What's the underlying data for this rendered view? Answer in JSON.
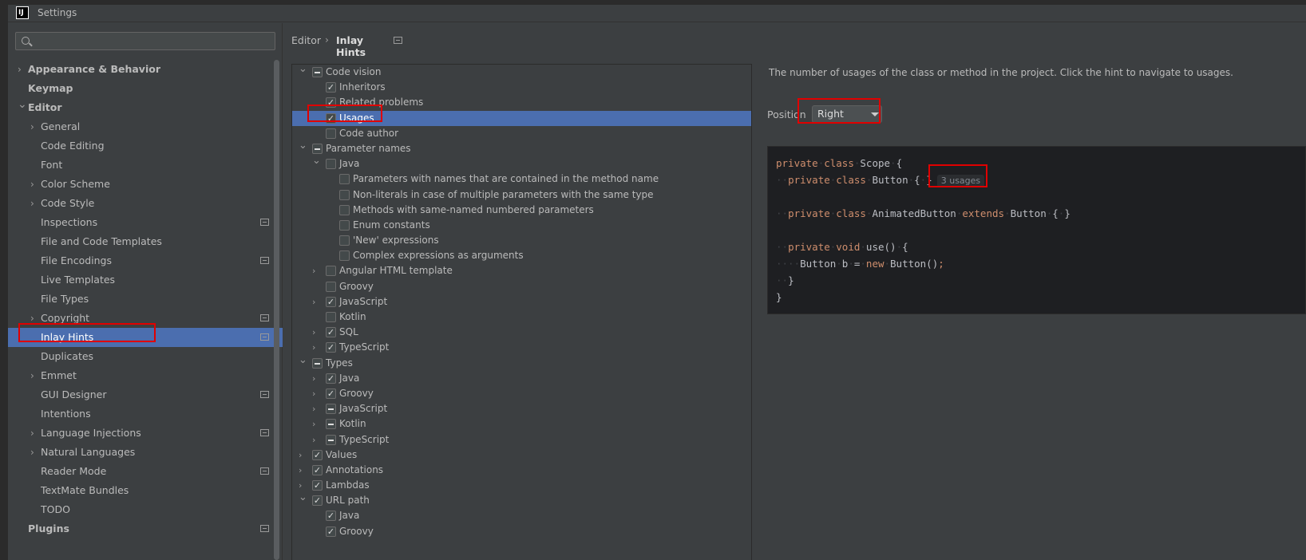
{
  "window": {
    "title": "Settings"
  },
  "search": {
    "placeholder": ""
  },
  "sidebar": {
    "items": [
      {
        "label": "Appearance & Behavior",
        "level": 0,
        "bold": true,
        "chevron": "right",
        "icon": false,
        "selected": false
      },
      {
        "label": "Keymap",
        "level": 0,
        "bold": true,
        "chevron": "",
        "icon": false,
        "selected": false
      },
      {
        "label": "Editor",
        "level": 0,
        "bold": true,
        "chevron": "down",
        "icon": false,
        "selected": false
      },
      {
        "label": "General",
        "level": 1,
        "bold": false,
        "chevron": "right",
        "icon": false,
        "selected": false
      },
      {
        "label": "Code Editing",
        "level": 1,
        "bold": false,
        "chevron": "",
        "icon": false,
        "selected": false
      },
      {
        "label": "Font",
        "level": 1,
        "bold": false,
        "chevron": "",
        "icon": false,
        "selected": false
      },
      {
        "label": "Color Scheme",
        "level": 1,
        "bold": false,
        "chevron": "right",
        "icon": false,
        "selected": false
      },
      {
        "label": "Code Style",
        "level": 1,
        "bold": false,
        "chevron": "right",
        "icon": false,
        "selected": false
      },
      {
        "label": "Inspections",
        "level": 1,
        "bold": false,
        "chevron": "",
        "icon": true,
        "selected": false
      },
      {
        "label": "File and Code Templates",
        "level": 1,
        "bold": false,
        "chevron": "",
        "icon": false,
        "selected": false
      },
      {
        "label": "File Encodings",
        "level": 1,
        "bold": false,
        "chevron": "",
        "icon": true,
        "selected": false
      },
      {
        "label": "Live Templates",
        "level": 1,
        "bold": false,
        "chevron": "",
        "icon": false,
        "selected": false
      },
      {
        "label": "File Types",
        "level": 1,
        "bold": false,
        "chevron": "",
        "icon": false,
        "selected": false
      },
      {
        "label": "Copyright",
        "level": 1,
        "bold": false,
        "chevron": "right",
        "icon": true,
        "selected": false
      },
      {
        "label": "Inlay Hints",
        "level": 1,
        "bold": false,
        "chevron": "",
        "icon": true,
        "selected": true
      },
      {
        "label": "Duplicates",
        "level": 1,
        "bold": false,
        "chevron": "",
        "icon": false,
        "selected": false
      },
      {
        "label": "Emmet",
        "level": 1,
        "bold": false,
        "chevron": "right",
        "icon": false,
        "selected": false
      },
      {
        "label": "GUI Designer",
        "level": 1,
        "bold": false,
        "chevron": "",
        "icon": true,
        "selected": false
      },
      {
        "label": "Intentions",
        "level": 1,
        "bold": false,
        "chevron": "",
        "icon": false,
        "selected": false
      },
      {
        "label": "Language Injections",
        "level": 1,
        "bold": false,
        "chevron": "right",
        "icon": true,
        "selected": false
      },
      {
        "label": "Natural Languages",
        "level": 1,
        "bold": false,
        "chevron": "right",
        "icon": false,
        "selected": false
      },
      {
        "label": "Reader Mode",
        "level": 1,
        "bold": false,
        "chevron": "",
        "icon": true,
        "selected": false
      },
      {
        "label": "TextMate Bundles",
        "level": 1,
        "bold": false,
        "chevron": "",
        "icon": false,
        "selected": false
      },
      {
        "label": "TODO",
        "level": 1,
        "bold": false,
        "chevron": "",
        "icon": false,
        "selected": false
      },
      {
        "label": "Plugins",
        "level": 0,
        "bold": true,
        "chevron": "",
        "icon": true,
        "selected": false
      }
    ]
  },
  "breadcrumb": {
    "root": "Editor",
    "separator": "›",
    "page": "Inlay Hints"
  },
  "hints": [
    {
      "label": "Code vision",
      "level": 0,
      "chevron": "down",
      "check": "partial",
      "selected": false
    },
    {
      "label": "Inheritors",
      "level": 1,
      "chevron": "",
      "check": "checked",
      "selected": false
    },
    {
      "label": "Related problems",
      "level": 1,
      "chevron": "",
      "check": "checked",
      "selected": false
    },
    {
      "label": "Usages",
      "level": 1,
      "chevron": "",
      "check": "checked",
      "selected": true
    },
    {
      "label": "Code author",
      "level": 1,
      "chevron": "",
      "check": "unchecked",
      "selected": false
    },
    {
      "label": "Parameter names",
      "level": 0,
      "chevron": "down",
      "check": "partial",
      "selected": false
    },
    {
      "label": "Java",
      "level": 1,
      "chevron": "down",
      "check": "unchecked",
      "selected": false
    },
    {
      "label": "Parameters with names that are contained in the method name",
      "level": 2,
      "chevron": "",
      "check": "unchecked",
      "selected": false
    },
    {
      "label": "Non-literals in case of multiple parameters with the same type",
      "level": 2,
      "chevron": "",
      "check": "unchecked",
      "selected": false
    },
    {
      "label": "Methods with same-named numbered parameters",
      "level": 2,
      "chevron": "",
      "check": "unchecked",
      "selected": false
    },
    {
      "label": "Enum constants",
      "level": 2,
      "chevron": "",
      "check": "unchecked",
      "selected": false
    },
    {
      "label": "'New' expressions",
      "level": 2,
      "chevron": "",
      "check": "unchecked",
      "selected": false
    },
    {
      "label": "Complex expressions as arguments",
      "level": 2,
      "chevron": "",
      "check": "unchecked",
      "selected": false
    },
    {
      "label": "Angular HTML template",
      "level": 1,
      "chevron": "right",
      "check": "unchecked",
      "selected": false
    },
    {
      "label": "Groovy",
      "level": 1,
      "chevron": "",
      "check": "unchecked",
      "selected": false
    },
    {
      "label": "JavaScript",
      "level": 1,
      "chevron": "right",
      "check": "checked",
      "selected": false
    },
    {
      "label": "Kotlin",
      "level": 1,
      "chevron": "",
      "check": "unchecked",
      "selected": false
    },
    {
      "label": "SQL",
      "level": 1,
      "chevron": "right",
      "check": "checked",
      "selected": false
    },
    {
      "label": "TypeScript",
      "level": 1,
      "chevron": "right",
      "check": "checked",
      "selected": false
    },
    {
      "label": "Types",
      "level": 0,
      "chevron": "down",
      "check": "partial",
      "selected": false
    },
    {
      "label": "Java",
      "level": 1,
      "chevron": "right",
      "check": "checked",
      "selected": false
    },
    {
      "label": "Groovy",
      "level": 1,
      "chevron": "right",
      "check": "checked",
      "selected": false
    },
    {
      "label": "JavaScript",
      "level": 1,
      "chevron": "right",
      "check": "partial",
      "selected": false
    },
    {
      "label": "Kotlin",
      "level": 1,
      "chevron": "right",
      "check": "partial",
      "selected": false
    },
    {
      "label": "TypeScript",
      "level": 1,
      "chevron": "right",
      "check": "partial",
      "selected": false
    },
    {
      "label": "Values",
      "level": 0,
      "chevron": "right",
      "check": "checked",
      "selected": false
    },
    {
      "label": "Annotations",
      "level": 0,
      "chevron": "right",
      "check": "checked",
      "selected": false
    },
    {
      "label": "Lambdas",
      "level": 0,
      "chevron": "right",
      "check": "checked",
      "selected": false
    },
    {
      "label": "URL path",
      "level": 0,
      "chevron": "down",
      "check": "checked",
      "selected": false
    },
    {
      "label": "Java",
      "level": 1,
      "chevron": "",
      "check": "checked",
      "selected": false
    },
    {
      "label": "Groovy",
      "level": 1,
      "chevron": "",
      "check": "checked",
      "selected": false
    }
  ],
  "detail": {
    "description": "The number of usages of the class or method in the project. Click the hint to navigate to usages.",
    "position_label": "Position",
    "position_value": "Right",
    "inlay_text": "3 usages"
  },
  "code_lines": [
    [
      [
        "kw",
        "private"
      ],
      [
        "ws",
        "·"
      ],
      [
        "kw",
        "class"
      ],
      [
        "ws",
        "·"
      ],
      [
        "",
        "Scope"
      ],
      [
        "ws",
        "·"
      ],
      [
        "",
        "{"
      ]
    ],
    [
      [
        "ws",
        "··"
      ],
      [
        "kw",
        "private"
      ],
      [
        "ws",
        "·"
      ],
      [
        "kw",
        "class"
      ],
      [
        "ws",
        "·"
      ],
      [
        "",
        "Button"
      ],
      [
        "ws",
        "·"
      ],
      [
        "",
        "{"
      ],
      [
        "ws",
        "·"
      ],
      [
        "",
        "}"
      ],
      [
        "inlay",
        ""
      ]
    ],
    [],
    [
      [
        "ws",
        "··"
      ],
      [
        "kw",
        "private"
      ],
      [
        "ws",
        "·"
      ],
      [
        "kw",
        "class"
      ],
      [
        "ws",
        "·"
      ],
      [
        "",
        "AnimatedButton"
      ],
      [
        "ws",
        "·"
      ],
      [
        "kw",
        "extends"
      ],
      [
        "ws",
        "·"
      ],
      [
        "",
        "Button"
      ],
      [
        "ws",
        "·"
      ],
      [
        "",
        "{"
      ],
      [
        "ws",
        "·"
      ],
      [
        "",
        "}"
      ]
    ],
    [],
    [
      [
        "ws",
        "··"
      ],
      [
        "kw",
        "private"
      ],
      [
        "ws",
        "·"
      ],
      [
        "kw",
        "void"
      ],
      [
        "ws",
        "·"
      ],
      [
        "",
        "use()"
      ],
      [
        "ws",
        "·"
      ],
      [
        "",
        "{"
      ]
    ],
    [
      [
        "ws",
        "····"
      ],
      [
        "",
        "Button"
      ],
      [
        "ws",
        "·"
      ],
      [
        "",
        "b"
      ],
      [
        "ws",
        "·"
      ],
      [
        "",
        "="
      ],
      [
        "ws",
        "·"
      ],
      [
        "kw",
        "new"
      ],
      [
        "ws",
        "·"
      ],
      [
        "",
        "Button()"
      ],
      [
        "kw",
        ";"
      ]
    ],
    [
      [
        "ws",
        "··"
      ],
      [
        "",
        "}"
      ]
    ],
    [
      [
        "",
        "}"
      ]
    ]
  ],
  "colors": {
    "accent": "#4b6eaf",
    "highlight": "#e00000",
    "keyword": "#cf8e6d"
  }
}
